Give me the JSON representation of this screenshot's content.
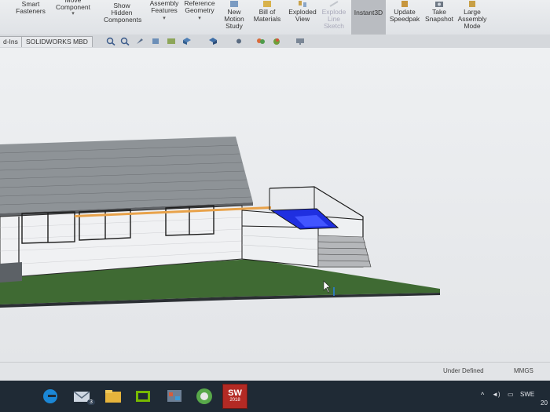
{
  "ribbon": {
    "smart_fasteners": "Smart\nFasteners",
    "move_component": "Move\nComponent",
    "show_hidden_components": "Show\nHidden\nComponents",
    "assembly_features": "Assembly\nFeatures",
    "reference_geometry": "Reference\nGeometry",
    "new_motion_study": "New\nMotion\nStudy",
    "bill_of_materials": "Bill of\nMaterials",
    "exploded_view": "Exploded\nView",
    "explode_line_sketch": "Explode\nLine\nSketch",
    "instant3d": "Instant3D",
    "update_speedpak": "Update\nSpeedpak",
    "take_snapshot": "Take\nSnapshot",
    "large_assembly_mode": "Large\nAssembly\nMode"
  },
  "tabs": {
    "addins": "d-Ins",
    "mbd": "SOLIDWORKS MBD"
  },
  "status": {
    "state": "Under Defined",
    "units": "MMGS"
  },
  "tray": {
    "lang": "SWE",
    "clock": "20"
  },
  "taskbar": {
    "mail_badge": "3",
    "sw_label": "SW",
    "sw_year": "2018"
  },
  "colors": {
    "ground": "#3f6a33",
    "pool": "#1f2fe0",
    "beam": "#e8a24a",
    "roof": "#8e9397"
  }
}
